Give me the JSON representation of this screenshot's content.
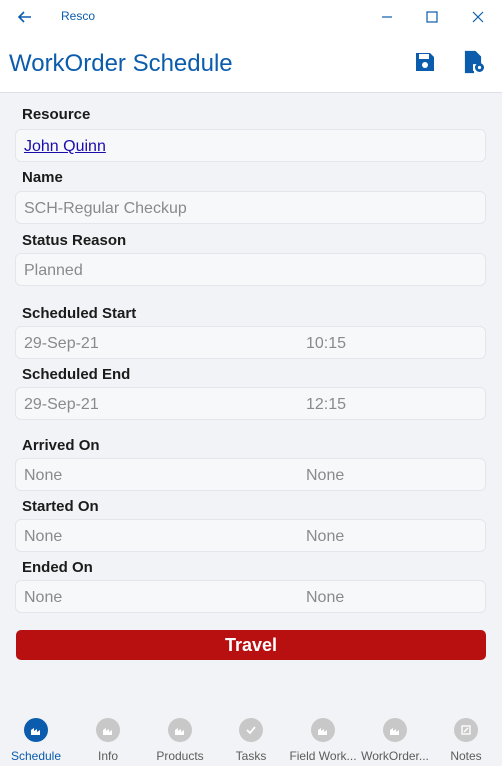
{
  "window": {
    "app_name": "Resco",
    "controls": [
      "minimize",
      "maximize",
      "close"
    ]
  },
  "header": {
    "title": "WorkOrder Schedule",
    "actions": [
      {
        "icon": "save-icon"
      },
      {
        "icon": "document-settings-icon"
      }
    ]
  },
  "form": {
    "resource": {
      "label": "Resource",
      "value": "John Quinn"
    },
    "name": {
      "label": "Name",
      "value": "SCH-Regular Checkup"
    },
    "status_reason": {
      "label": "Status Reason",
      "value": "Planned"
    },
    "scheduled_start": {
      "label": "Scheduled Start",
      "date": "29-Sep-21",
      "time": "10:15"
    },
    "scheduled_end": {
      "label": "Scheduled End",
      "date": "29-Sep-21",
      "time": "12:15"
    },
    "arrived_on": {
      "label": "Arrived On",
      "date": "None",
      "time": "None"
    },
    "started_on": {
      "label": "Started On",
      "date": "None",
      "time": "None"
    },
    "ended_on": {
      "label": "Ended On",
      "date": "None",
      "time": "None"
    }
  },
  "travel_button": {
    "label": "Travel",
    "color": "#b80f10"
  },
  "tabs": [
    {
      "label": "Schedule",
      "active": true
    },
    {
      "label": "Info",
      "active": false
    },
    {
      "label": "Products",
      "active": false
    },
    {
      "label": "Tasks",
      "active": false
    },
    {
      "label": "Field Work...",
      "active": false
    },
    {
      "label": "WorkOrder...",
      "active": false
    },
    {
      "label": "Notes",
      "active": false
    }
  ],
  "colors": {
    "accent": "#0b5cad",
    "travel": "#b80f10"
  }
}
